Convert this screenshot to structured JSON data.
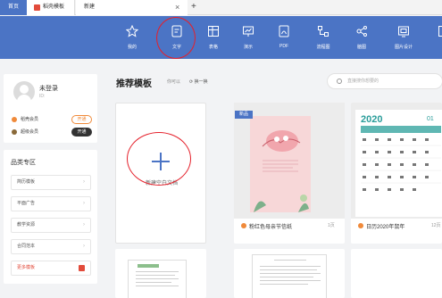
{
  "tabs": {
    "home": "首页",
    "wps": "稻壳模板",
    "new": "新建",
    "close": "×",
    "add": "+"
  },
  "toolbar": {
    "items": [
      {
        "label": "我的",
        "icon": "star-icon"
      },
      {
        "label": "文字",
        "icon": "document-icon"
      },
      {
        "label": "表格",
        "icon": "table-icon"
      },
      {
        "label": "演示",
        "icon": "presentation-icon"
      },
      {
        "label": "PDF",
        "icon": "pdf-icon"
      },
      {
        "label": "流程图",
        "icon": "flowchart-icon"
      },
      {
        "label": "脑图",
        "icon": "mindmap-icon"
      },
      {
        "label": "图片设计",
        "icon": "image-design-icon"
      }
    ],
    "color": "#4b74c5"
  },
  "user": {
    "login": "未登录",
    "id": "ID:",
    "members": [
      {
        "label": "稻壳会员",
        "button": "开通",
        "color": "#f08a3a"
      },
      {
        "label": "超级会员",
        "button": "开通",
        "color": "#333333"
      }
    ]
  },
  "categories": {
    "title": "品类专区",
    "items": [
      "简历模板",
      "平面广告",
      "教学资源",
      "合同范本",
      "更多模板"
    ]
  },
  "main": {
    "heading": "推荐模板",
    "also": "你可以",
    "refresh": "换一换",
    "search_placeholder": "直接搜你想要的",
    "new_blank": "新建空白文档"
  },
  "templates": [
    {
      "name": "粉红色母亲节信纸",
      "pages": "1页",
      "badge": "新品"
    },
    {
      "name": "日历2020年鼠年",
      "pages": "12页"
    }
  ],
  "accent": "#e5202b"
}
